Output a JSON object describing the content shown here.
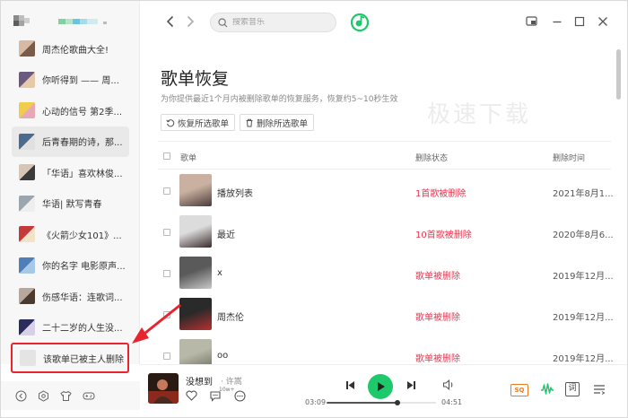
{
  "sidebar": {
    "items": [
      {
        "label": "周杰伦歌曲大全!",
        "thumb": "#d8b9a2",
        "thumb2": "#7a5a4a"
      },
      {
        "label": "你听得到 —— 周...",
        "thumb": "#6b5a7e",
        "thumb2": "#e6c9a8"
      },
      {
        "label": "心动的信号 第2季...",
        "thumb": "#f2cc4c",
        "thumb2": "#e7a9b8"
      },
      {
        "label": "后青春期的诗，那...",
        "thumb": "#4a6a8e",
        "thumb2": "#e0e0e0",
        "active": true
      },
      {
        "label": "「华语」喜欢林俊...",
        "thumb": "#d7c6b5",
        "thumb2": "#3a3a3a"
      },
      {
        "label": "华语| 默写青春",
        "thumb": "#99a6b0",
        "thumb2": "#eeeeee"
      },
      {
        "label": "《火箭少女101》...",
        "thumb": "#c43a3a",
        "thumb2": "#f2e3c8"
      },
      {
        "label": "你的名字 电影原声...",
        "thumb": "#4f7fb8",
        "thumb2": "#a7c9e8"
      },
      {
        "label": "伤感华语：连歌词...",
        "thumb": "#b8a79a",
        "thumb2": "#4a3b30"
      },
      {
        "label": "二十二岁的人生没...",
        "thumb": "#2c2c5a",
        "thumb2": "#d8d0e8"
      }
    ],
    "deleted_item": {
      "label": "该歌单已被主人删除"
    }
  },
  "header": {
    "search_placeholder": "搜索音乐",
    "accent": "#1ec96b"
  },
  "main": {
    "title": "歌单恢复",
    "description": "为你提供最近1个月内被删除歌单的恢复服务，恢复约5~10秒生效",
    "watermark": "极速下载",
    "restore_button": "恢复所选歌单",
    "delete_button": "删除所选歌单",
    "columns": {
      "name": "歌单",
      "status": "删除状态",
      "date": "删除时间"
    },
    "rows": [
      {
        "name": "播放列表",
        "status": "1首歌被删除",
        "date": "2021年8月1...",
        "cover": "#c9b0a0",
        "cover2": "#4a3a3a"
      },
      {
        "name": "最近",
        "status": "10首歌被删除",
        "date": "2020年8月6...",
        "cover": "#dcdcdc",
        "cover2": "#3a2a2a"
      },
      {
        "name": "x",
        "status": "歌单被删除",
        "date": "2019年12月...",
        "cover": "#5a5a5a",
        "cover2": "#c8c8c8"
      },
      {
        "name": "周杰伦",
        "status": "歌单被删除",
        "date": "2019年12月...",
        "cover": "#2a2a2a",
        "cover2": "#b83030"
      },
      {
        "name": "oo",
        "status": "歌单被删除",
        "date": "2019年12月...",
        "cover": "#b8b8a8",
        "cover2": "#6a6a5a"
      }
    ],
    "status_color": "#e8364f"
  },
  "player": {
    "title": "没想到",
    "artist": "· 许嵩",
    "comment_count": "10w+",
    "current_time": "03:09",
    "total_time": "04:51",
    "progress": 0.65,
    "quality": "SQ",
    "lyric_label": "词"
  },
  "annotation": {
    "arrow_color": "#e8252f",
    "box_color": "#e8252f"
  }
}
